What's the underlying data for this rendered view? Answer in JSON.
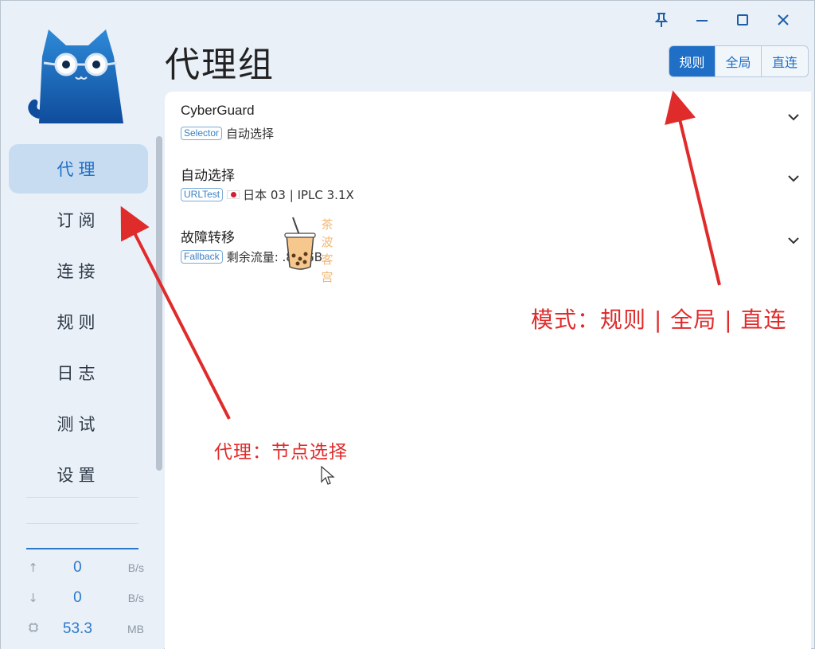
{
  "window": {
    "controls": [
      "pin-icon",
      "minimize-icon",
      "maximize-icon",
      "close-icon"
    ]
  },
  "sidebar": {
    "items": [
      {
        "label": "代理",
        "active": true
      },
      {
        "label": "订阅",
        "active": false
      },
      {
        "label": "连接",
        "active": false
      },
      {
        "label": "规则",
        "active": false
      },
      {
        "label": "日志",
        "active": false
      },
      {
        "label": "测试",
        "active": false
      },
      {
        "label": "设置",
        "active": false
      }
    ],
    "traffic": {
      "upload": {
        "value": "0",
        "unit": "B/s",
        "icon": "arrow-up-icon"
      },
      "download": {
        "value": "0",
        "unit": "B/s",
        "icon": "arrow-down-icon"
      },
      "memory": {
        "value": "53.3",
        "unit": "MB",
        "icon": "chip-icon"
      }
    }
  },
  "header": {
    "title": "代理组",
    "modes": [
      {
        "label": "规则",
        "active": true
      },
      {
        "label": "全局",
        "active": false
      },
      {
        "label": "直连",
        "active": false
      }
    ]
  },
  "groups": [
    {
      "name": "CyberGuard",
      "type": "Selector",
      "selected": "自动选择",
      "flag": ""
    },
    {
      "name": "自动选择",
      "type": "URLTest",
      "selected": "日本 03 | IPLC 3.1X",
      "flag": "jp-flag"
    },
    {
      "name": "故障转移",
      "type": "Fallback",
      "selected": "剩余流量: .81 GB",
      "flag": ""
    }
  ],
  "annotations": {
    "proxy_note": "代理：节点选择",
    "mode_note": "模式：规则 | 全局 | 直连"
  },
  "watermark": {
    "text": "茶 波 客 宫"
  },
  "colors": {
    "accent": "#1f6fc6",
    "annotation": "#e02b2b",
    "sidebar_bg": "#e9f0f8"
  }
}
